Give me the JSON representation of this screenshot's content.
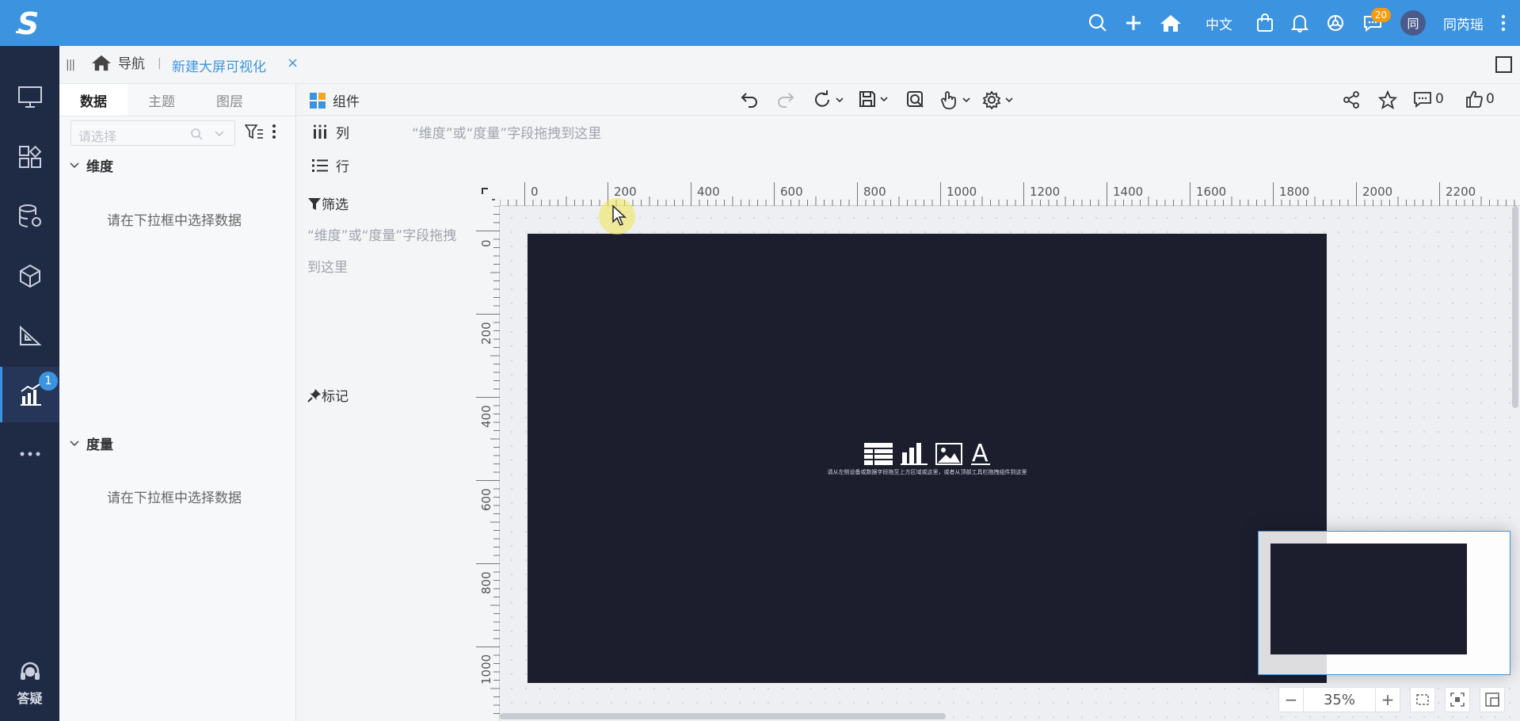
{
  "header": {
    "lang": "中文",
    "chat_badge": "20",
    "avatar_char": "同",
    "username": "同芮瑶"
  },
  "sidebar": {
    "active_badge": "1",
    "help_label": "答疑"
  },
  "tabs": {
    "home_label": "导航",
    "separator": "|",
    "current_label": "新建大屏可视化",
    "close_glyph": "×"
  },
  "data_panel": {
    "tabs": [
      "数据",
      "主题",
      "图层"
    ],
    "select_placeholder": "请选择",
    "dimension_title": "维度",
    "measure_title": "度量",
    "empty_tip": "请在下拉框中选择数据"
  },
  "shelf": {
    "component_label": "组件",
    "columns_label": "列",
    "rows_label": "行",
    "drop_hint": "“维度”或“度量”字段拖拽到这里",
    "comment_count": "0",
    "like_count": "0"
  },
  "marks": {
    "filter_title": "筛选",
    "filter_hint": "“维度”或“度量”字段拖拽到这里",
    "marks_title": "标记"
  },
  "canvas": {
    "h_ruler_labels": [
      "0",
      "200",
      "400",
      "600",
      "800",
      "1000",
      "1200",
      "1400",
      "1600",
      "1800",
      "2000",
      "2200"
    ],
    "v_ruler_labels": [
      "0",
      "200",
      "400",
      "600",
      "800",
      "1000"
    ],
    "screen_hint": "请从左侧设备或数据字段拖至上方区域或这里，或者从顶部工具栏拖拽组件到这里",
    "zoom": "35%",
    "screen_bg": "#1c1e2e"
  },
  "colors": {
    "accent": "#3c93e0",
    "sidebar_bg": "#1f2a45",
    "badge_orange": "#f39c12"
  }
}
